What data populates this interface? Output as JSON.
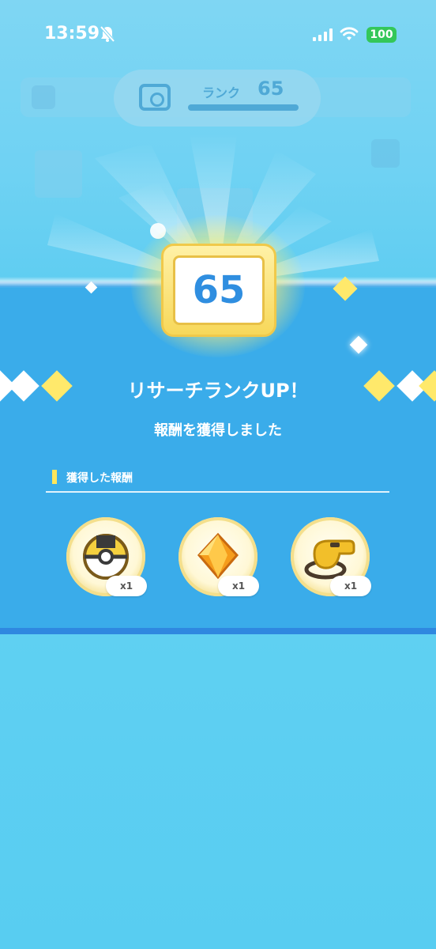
{
  "status_bar": {
    "time": "13:59",
    "battery": "100"
  },
  "rank_header": {
    "label": "ランク",
    "value": "65"
  },
  "badge": {
    "rank": "65"
  },
  "title": "リサーチランクUP！",
  "subtitle": "報酬を獲得しました",
  "rewards_section": {
    "label": "獲得した報酬",
    "items": [
      {
        "icon": "ultra-ball-icon",
        "quantity": "x1"
      },
      {
        "icon": "amber-crystal-icon",
        "quantity": "x1"
      },
      {
        "icon": "whistle-icon",
        "quantity": "x1"
      }
    ]
  },
  "colors": {
    "band": "#3aacea",
    "badge_gold": "#f7d85a",
    "rank_text": "#2f8ee0",
    "accent_yellow": "#ffe65a"
  }
}
